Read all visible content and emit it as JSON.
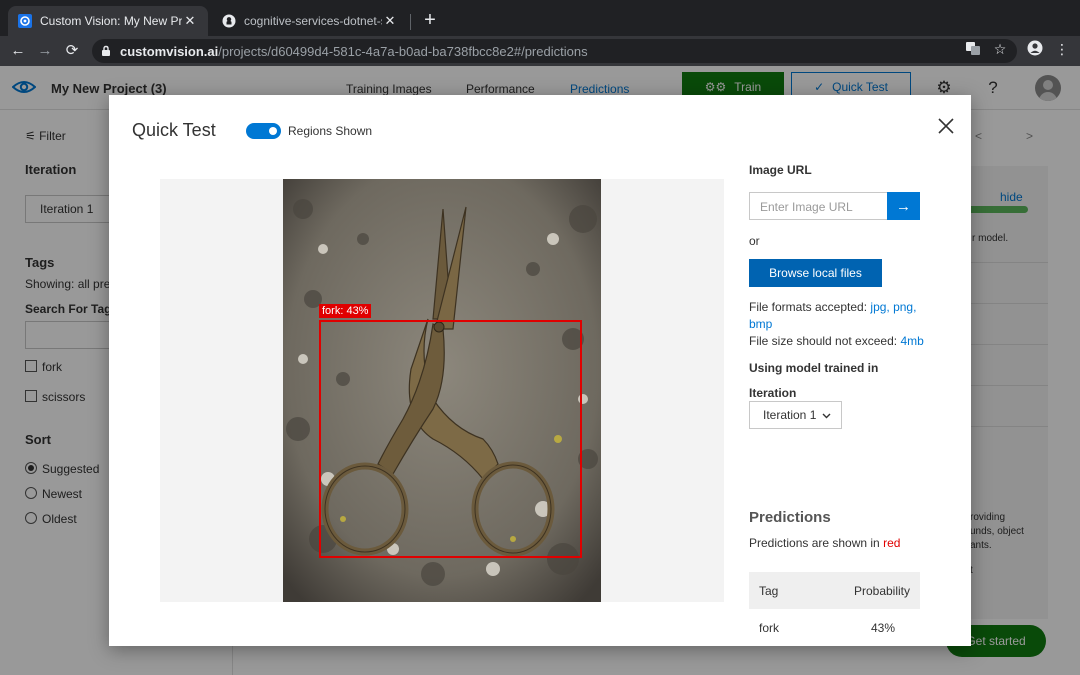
{
  "browser": {
    "tabs": [
      {
        "title": "Custom Vision: My New Project",
        "active": true
      },
      {
        "title": "cognitive-services-dotnet-sdk",
        "active": false
      }
    ],
    "url_host": "customvision.ai",
    "url_path": "/projects/d60499d4-581c-4a7a-b0ad-ba738fbcc8e2#/predictions"
  },
  "app": {
    "project_name": "My New Project (3)",
    "nav": [
      "Training Images",
      "Performance",
      "Predictions"
    ],
    "active_nav": "Predictions",
    "train_label": "Train",
    "quick_test_label": "Quick Test",
    "help_label": "?",
    "colors": {
      "accent": "#0078d4",
      "train": "#107c10",
      "region": "#e00000"
    }
  },
  "sidebar": {
    "filter_label": "Filter",
    "iteration_heading": "Iteration",
    "iteration_value": "Iteration 1",
    "tags_heading": "Tags",
    "showing_text": "Showing: all pre",
    "search_heading": "Search For Tags",
    "tags": [
      "fork",
      "scissors"
    ],
    "sort_heading": "Sort",
    "sort_options": [
      "Suggested",
      "Newest",
      "Oldest"
    ],
    "sort_selected": "Suggested"
  },
  "right_panel": {
    "hide_label": "hide",
    "text_model": "r model.",
    "text_line1": "roviding",
    "text_line2": "unds, object",
    "text_line3": "ants.",
    "text_line4": "t",
    "get_started_label": "Get started"
  },
  "quick_test": {
    "title": "Quick Test",
    "regions_toggle_label": "Regions Shown",
    "regions_shown": true,
    "image_url_heading": "Image URL",
    "image_url_placeholder": "Enter Image URL",
    "or_text": "or",
    "browse_label": "Browse local files",
    "formats_prefix": "File formats accepted:",
    "formats_value_1": "jpg, png,",
    "formats_value_2": "bmp",
    "size_prefix": "File size should not exceed:",
    "size_value": "4mb",
    "model_heading": "Using model trained in",
    "iteration_label": "Iteration",
    "iteration_value": "Iteration 1",
    "predictions_heading": "Predictions",
    "predictions_note_prefix": "Predictions are shown in",
    "predictions_note_color": "red",
    "table_headers": [
      "Tag",
      "Probability"
    ],
    "predictions": [
      {
        "tag": "fork",
        "probability": "43%"
      }
    ],
    "region_label": "fork: 43%"
  }
}
